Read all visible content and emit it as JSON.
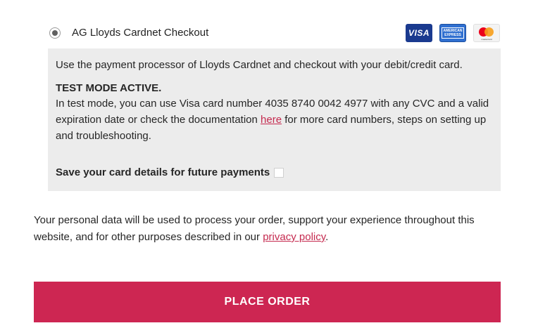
{
  "payment_method": {
    "label": "AG Lloyds Cardnet Checkout",
    "selected": true,
    "card_logos": {
      "visa": "VISA",
      "amex_line1": "AMERICAN",
      "amex_line2": "EXPRESS",
      "mastercard_text": "mastercard"
    }
  },
  "description": {
    "intro": "Use the payment processor of Lloyds Cardnet and checkout with your debit/credit card.",
    "test_heading": "TEST MODE ACTIVE.",
    "test_text_before": "In test mode, you can use Visa card number 4035 8740 0042 4977 with any CVC and a valid expiration date or check the documentation ",
    "test_link": "here",
    "test_text_after": " for more card numbers, steps on setting up and troubleshooting.",
    "save_card_label": "Save your card details for future payments"
  },
  "privacy": {
    "text_before": "Your personal data will be used to process your order, support your experience throughout this website, and for other purposes described in our ",
    "link": "privacy policy",
    "text_after": "."
  },
  "place_order_label": "PLACE ORDER",
  "colors": {
    "accent": "#cd2652",
    "link": "#c52a4f",
    "box_bg": "#ececec"
  }
}
